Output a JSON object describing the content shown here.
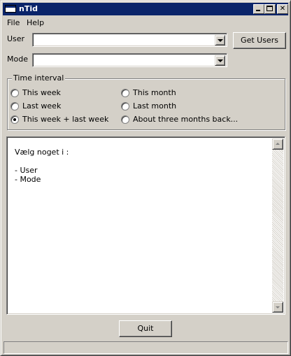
{
  "window": {
    "title": "nTid"
  },
  "menu": {
    "file": "File",
    "help": "Help"
  },
  "form": {
    "user_label": "User",
    "user_value": "",
    "mode_label": "Mode",
    "mode_value": "",
    "get_users_button": "Get Users"
  },
  "time_interval": {
    "legend": "Time interval",
    "options": [
      {
        "label": "This week",
        "checked": false
      },
      {
        "label": "This month",
        "checked": false
      },
      {
        "label": "Last week",
        "checked": false
      },
      {
        "label": "Last month",
        "checked": false
      },
      {
        "label": "This week + last week",
        "checked": true
      },
      {
        "label": "About three months back...",
        "checked": false
      }
    ]
  },
  "output": {
    "lines": [
      "Vælg noget i :",
      "",
      "- User",
      "- Mode"
    ]
  },
  "quit_button": "Quit",
  "status": ""
}
